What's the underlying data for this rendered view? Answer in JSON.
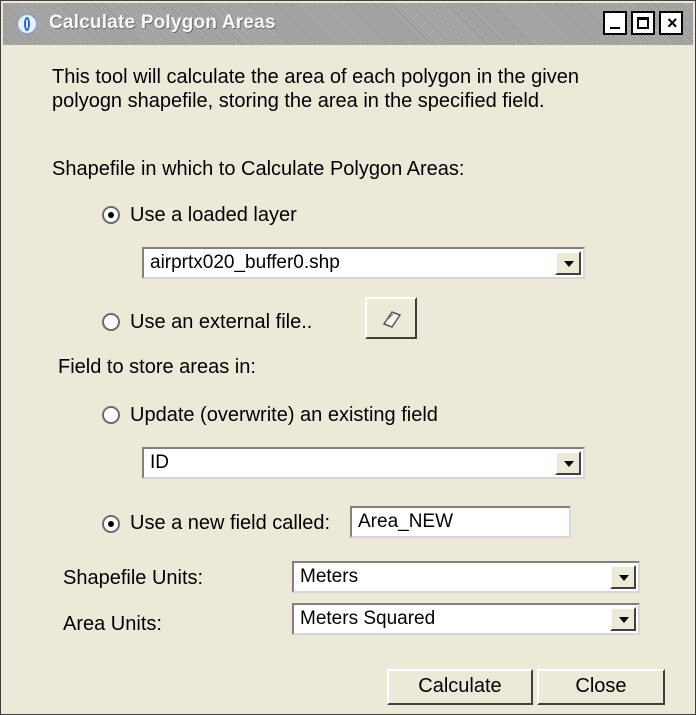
{
  "window": {
    "title": "Calculate Polygon Areas"
  },
  "description": {
    "line1": "This tool will calculate the area of each polygon in the given",
    "line2": "polyogn shapefile, storing the area in the specified field."
  },
  "shapefile_section": {
    "label": "Shapefile in which to Calculate Polygon Areas:",
    "use_loaded_layer": {
      "label": "Use a loaded layer",
      "checked": true
    },
    "layer_value": "airprtx020_buffer0.shp",
    "use_external_file": {
      "label": "Use an external file..",
      "checked": false
    },
    "browse_icon": "folder-icon"
  },
  "field_section": {
    "label": "Field to store areas in:",
    "update_existing": {
      "label": "Update (overwrite) an existing field",
      "checked": false
    },
    "existing_field_value": "ID",
    "use_new_field": {
      "label": "Use a new field called:",
      "checked": true
    },
    "new_field_value": "Area_NEW"
  },
  "units": {
    "shapefile_units_label": "Shapefile Units:",
    "shapefile_units_value": "Meters",
    "area_units_label": "Area Units:",
    "area_units_value": "Meters Squared"
  },
  "buttons": {
    "calculate": "Calculate",
    "close": "Close"
  }
}
